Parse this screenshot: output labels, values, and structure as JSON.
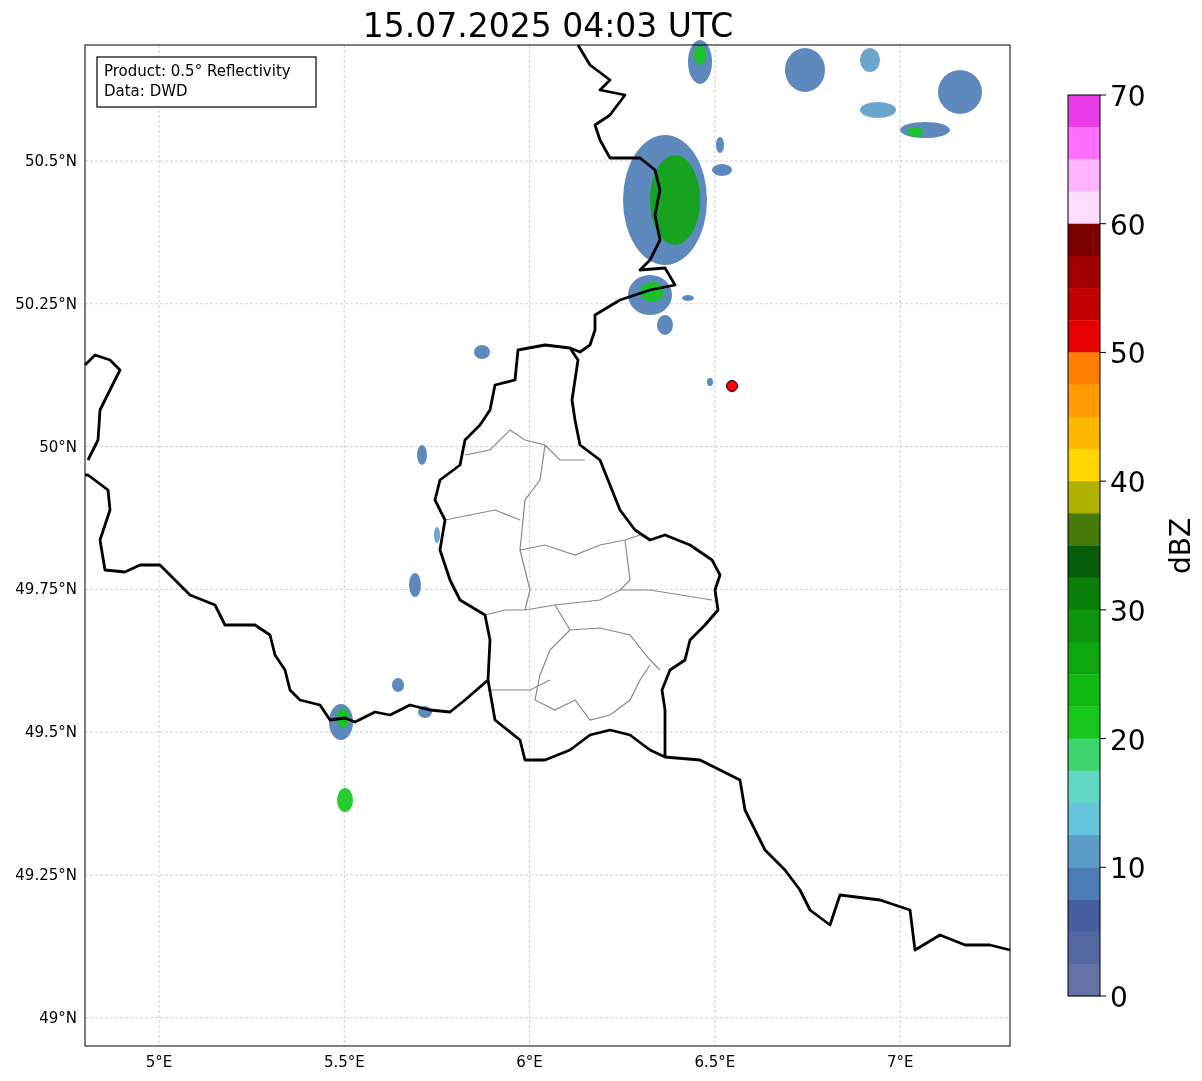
{
  "title": "15.07.2025 04:03 UTC",
  "info_box": {
    "lines": [
      "Product: 0.5° Reflectivity",
      "Data: DWD"
    ]
  },
  "lat_ticks": [
    "50.5°N",
    "50.25°N",
    "50°N",
    "49.75°N",
    "49.5°N",
    "49.25°N",
    "49°N"
  ],
  "lon_ticks": [
    "5°E",
    "5.5°E",
    "6°E",
    "6.5°E",
    "7°E"
  ],
  "colorbar": {
    "label": "dBZ",
    "ticks": [
      "70",
      "60",
      "50",
      "40",
      "30",
      "20",
      "10",
      "0"
    ],
    "levels": [
      {
        "color": "#e93ce8"
      },
      {
        "color": "#ff6eff"
      },
      {
        "color": "#ffb4ff"
      },
      {
        "color": "#ffddff"
      },
      {
        "color": "#7c0000"
      },
      {
        "color": "#a00000"
      },
      {
        "color": "#c00000"
      },
      {
        "color": "#e60000"
      },
      {
        "color": "#ff7e00"
      },
      {
        "color": "#ff9a00"
      },
      {
        "color": "#ffb800"
      },
      {
        "color": "#ffd700"
      },
      {
        "color": "#b0b000"
      },
      {
        "color": "#467a0a"
      },
      {
        "color": "#085e08"
      },
      {
        "color": "#0b800b"
      },
      {
        "color": "#0d930d"
      },
      {
        "color": "#0ea60e"
      },
      {
        "color": "#10b810"
      },
      {
        "color": "#13c81a"
      },
      {
        "color": "#3dd46e"
      },
      {
        "color": "#61d8c4"
      },
      {
        "color": "#66c4dd"
      },
      {
        "color": "#5b9cc6"
      },
      {
        "color": "#4b7cb5"
      },
      {
        "color": "#445ea0"
      },
      {
        "color": "#5266a0"
      },
      {
        "color": "#6472a6"
      }
    ]
  }
}
